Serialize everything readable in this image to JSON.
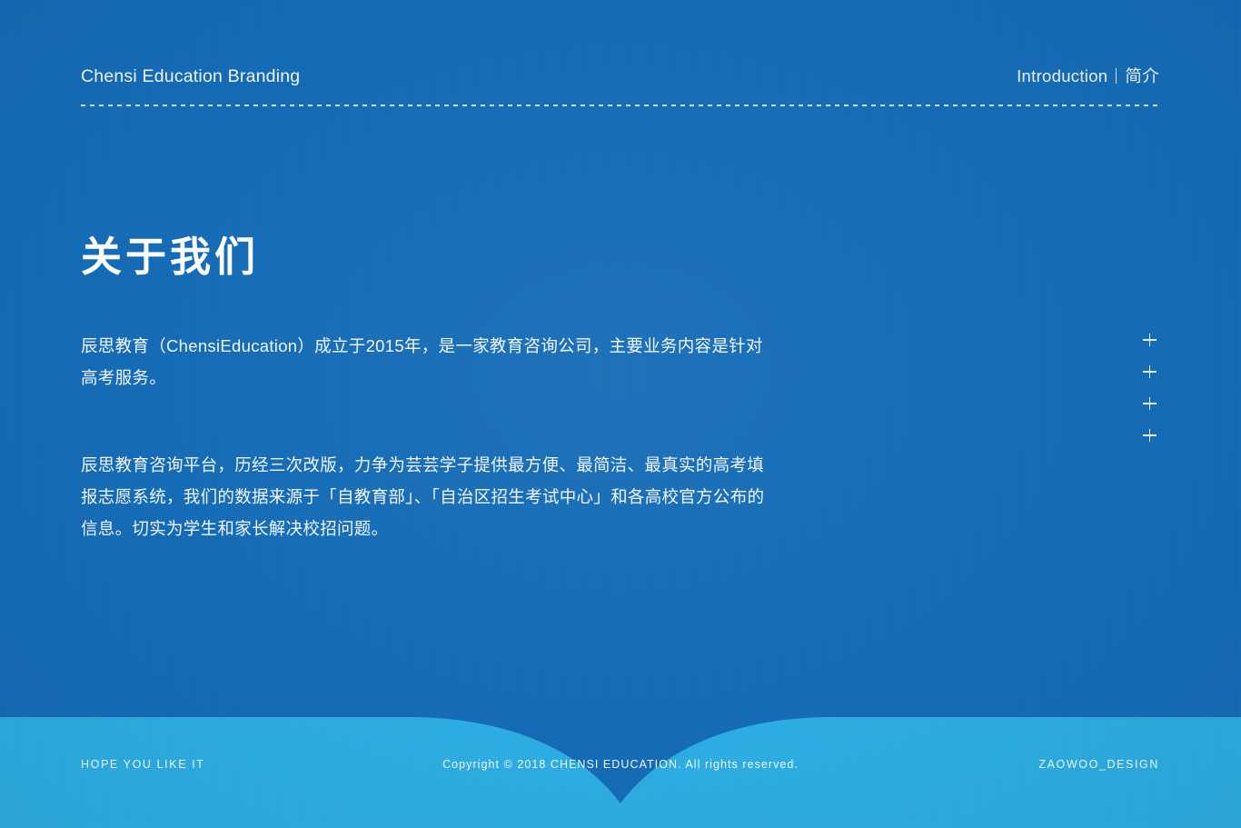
{
  "meta": {
    "bg_color": "#1169b5",
    "footer_color": "#29ace2",
    "text_color": "#f0f6fb"
  },
  "header": {
    "title": "Chensi Education Branding",
    "section_en": "Introduction",
    "separator": "|",
    "section_cn": "简介"
  },
  "main": {
    "heading": "关于我们",
    "paragraphs": [
      "辰思教育（ChensiEducation）成立于2015年，是一家教育咨询公司，主要业务内容是针对高考服务。",
      "辰思教育咨询平台，历经三次改版，力争为芸芸学子提供最方便、最简洁、最真实的高考填报志愿系统，我们的数据来源于「自教育部」、「自治区招生考试中心」和各高校官方公布的信息。切实为学生和家长解决校招问题。"
    ],
    "plus_marks": [
      "+",
      "+",
      "+",
      "+"
    ]
  },
  "footer": {
    "left": "HOPE YOU LIKE IT",
    "center": "Copyright © 2018 CHENSI EDUCATION. All rights reserved.",
    "right": "ZAOWOO_DESIGN"
  }
}
